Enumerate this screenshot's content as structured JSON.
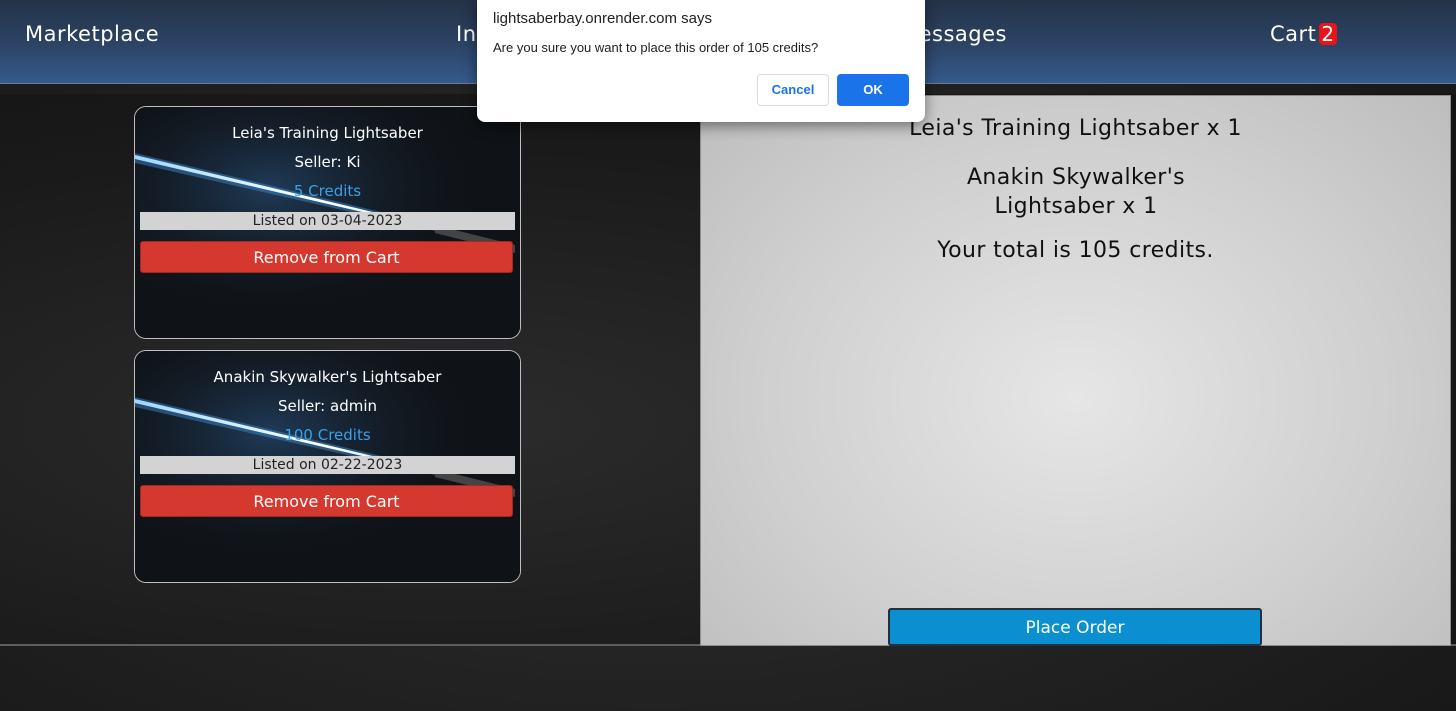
{
  "nav": {
    "marketplace": "Marketplace",
    "inventory": "Inventory",
    "messages": "Messages",
    "cart": "Cart",
    "cart_count": "2"
  },
  "cart_items": [
    {
      "title": "Leia's Training Lightsaber",
      "seller": "Seller: Ki",
      "price": "5 Credits",
      "listed": "Listed on 03-04-2023",
      "remove_label": "Remove from Cart"
    },
    {
      "title": "Anakin Skywalker's Lightsaber",
      "seller": "Seller: admin",
      "price": "100 Credits",
      "listed": "Listed on 02-22-2023",
      "remove_label": "Remove from Cart"
    }
  ],
  "summary": {
    "line1": "Leia's Training Lightsaber x 1",
    "line2": "Anakin Skywalker's Lightsaber x 1",
    "total": "Your total is 105 credits.",
    "place_order_label": "Place Order"
  },
  "dialog": {
    "title": "lightsaberbay.onrender.com says",
    "message": "Are you sure you want to place this order of 105 credits?",
    "cancel_label": "Cancel",
    "ok_label": "OK"
  },
  "colors": {
    "remove_button": "#d4382e",
    "price_text": "#3aa0e8",
    "place_order": "#0b8fd1",
    "badge": "#e8141a",
    "dialog_ok": "#1a73e8"
  }
}
